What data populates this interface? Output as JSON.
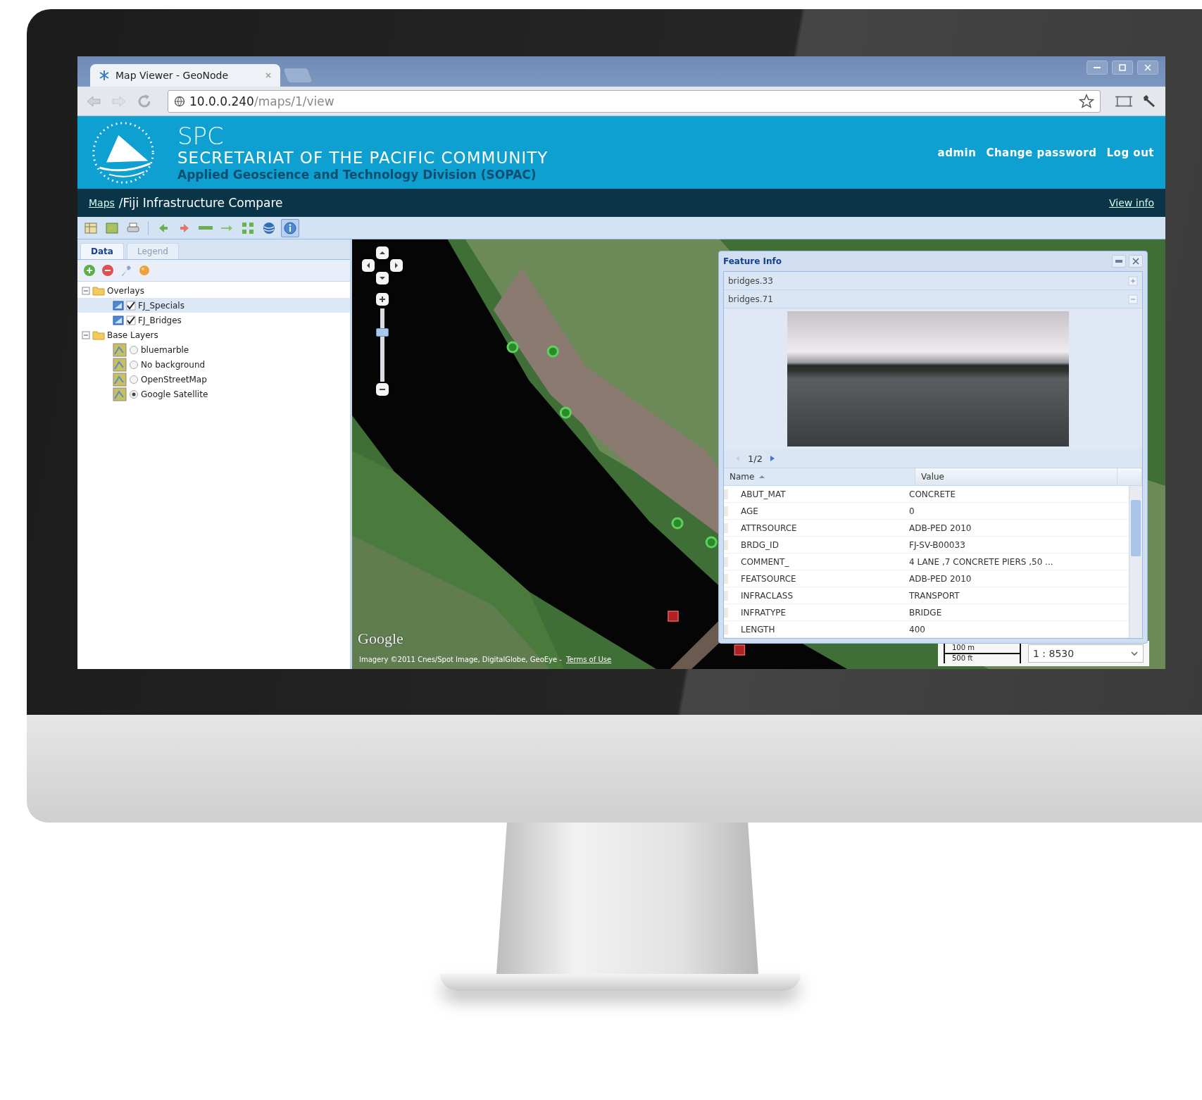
{
  "browser": {
    "tab_title": "Map Viewer - GeoNode",
    "url_host": "10.0.0.240",
    "url_path": "/maps/1/view"
  },
  "header": {
    "org_short": "SPC",
    "org_name": "SECRETARIAT OF THE PACIFIC COMMUNITY",
    "division": "Applied Geoscience and Technology Division (SOPAC)",
    "user_links": [
      "admin",
      "Change password",
      "Log out"
    ]
  },
  "breadcrumb": {
    "link": "Maps",
    "title": "/Fiji Infrastructure Compare",
    "view_info": "View info"
  },
  "toolbar": [
    {
      "kind": "layers",
      "selected": false
    },
    {
      "kind": "map",
      "selected": false
    },
    {
      "kind": "print",
      "selected": false
    },
    {
      "kind": "prev",
      "selected": false
    },
    {
      "kind": "next",
      "selected": false
    },
    {
      "kind": "line",
      "selected": false
    },
    {
      "kind": "arrow",
      "selected": false
    },
    {
      "kind": "extent",
      "selected": false
    },
    {
      "kind": "globe",
      "selected": false
    },
    {
      "kind": "info",
      "selected": true
    }
  ],
  "sidebar": {
    "tabs": [
      {
        "label": "Data",
        "selected": true
      },
      {
        "label": "Legend",
        "selected": false
      }
    ],
    "tree": [
      {
        "label": "Overlays",
        "expanded": true,
        "children": [
          {
            "kind": "overlay",
            "label": "FJ_Specials",
            "checked": true,
            "selected": true
          },
          {
            "kind": "overlay",
            "label": "FJ_Bridges",
            "checked": true,
            "selected": false
          }
        ]
      },
      {
        "label": "Base Layers",
        "expanded": true,
        "children": [
          {
            "kind": "base",
            "label": "bluemarble",
            "checked": false,
            "selected": false
          },
          {
            "kind": "base",
            "label": "No background",
            "checked": false,
            "selected": false
          },
          {
            "kind": "base",
            "label": "OpenStreetMap",
            "checked": false,
            "selected": false
          },
          {
            "kind": "base",
            "label": "Google Satellite",
            "checked": true,
            "selected": false
          }
        ]
      }
    ]
  },
  "map": {
    "zoom": {
      "level": 0.7
    },
    "attribution": {
      "logo": "Google",
      "text": "Imagery ©2011 Cnes/Spot Image, DigitalGlobe, GeoEye -",
      "link": "Terms of Use"
    },
    "scale": {
      "metric": "100 m",
      "imperial": "500 ft",
      "ratio": "1 : 8530"
    }
  },
  "feature_info": {
    "title": "Feature Info",
    "sections": [
      {
        "label": "bridges.33",
        "expanded": false
      },
      {
        "label": "bridges.71",
        "expanded": true
      }
    ],
    "pager": "1/2",
    "columns": [
      {
        "label": "Name",
        "sorted": true
      },
      {
        "label": "Value",
        "sorted": false
      }
    ],
    "rows": [
      [
        "ABUT_MAT",
        "CONCRETE"
      ],
      [
        "AGE",
        "0"
      ],
      [
        "ATTRSOURCE",
        "ADB-PED 2010"
      ],
      [
        "BRDG_ID",
        "FJ-SV-B00033"
      ],
      [
        "COMMENT_",
        "4 LANE ,7 CONCRETE PIERS ,50 ..."
      ],
      [
        "FEATSOURCE",
        "ADB-PED 2010"
      ],
      [
        "INFRACLASS",
        "TRANSPORT"
      ],
      [
        "INFRATYPE",
        "BRIDGE"
      ],
      [
        "LENGTH",
        "400"
      ]
    ]
  }
}
